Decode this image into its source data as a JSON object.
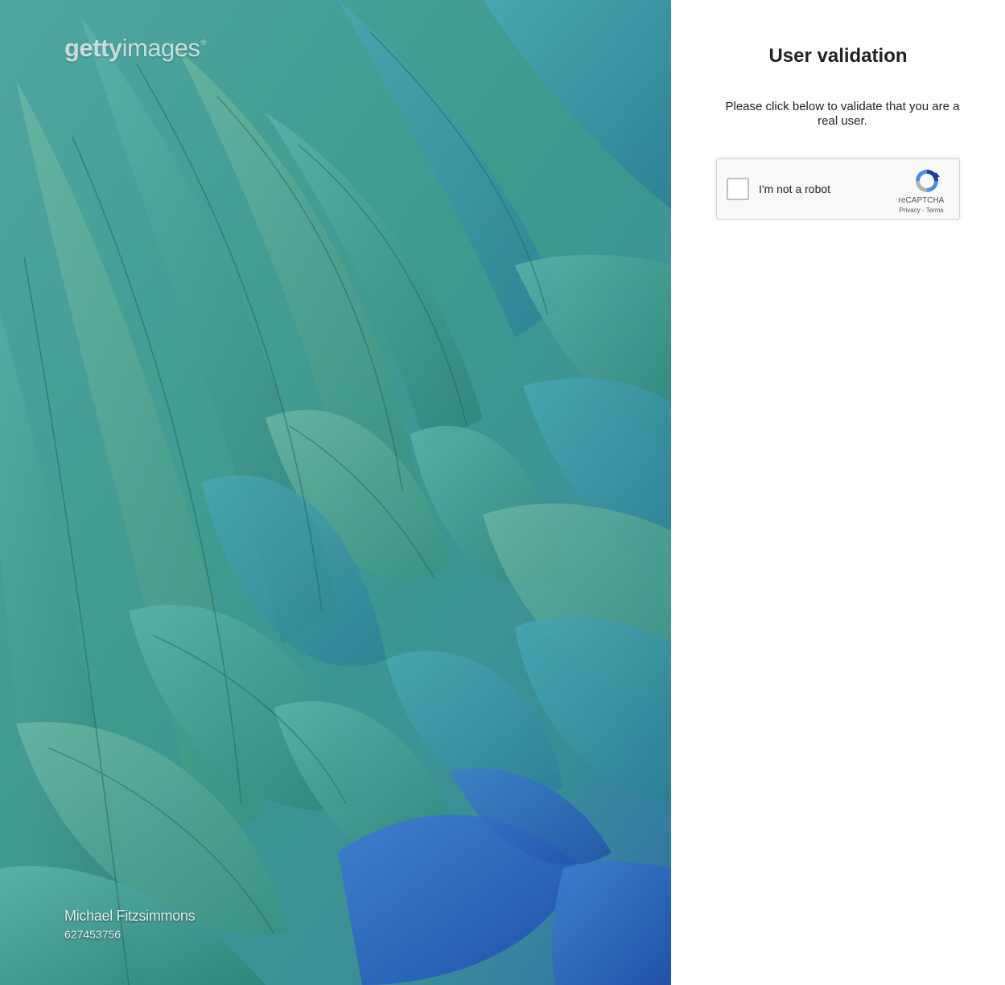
{
  "hero": {
    "logo_bold": "getty",
    "logo_light": "images",
    "logo_mark": "®",
    "photographer": "Michael Fitzsimmons",
    "image_number": "627453756"
  },
  "validation": {
    "title": "User validation",
    "description": "Please click below to validate that you are a real user."
  },
  "recaptcha": {
    "checkbox_label": "I'm not a robot",
    "brand": "reCAPTCHA",
    "privacy_label": "Privacy",
    "separator": "-",
    "terms_label": "Terms",
    "logo_icon": "recaptcha-logo-icon"
  },
  "colors": {
    "feather_teal": "#3f9c95",
    "feather_blue": "#2b5fb8",
    "recaptcha_blue": "#4a90e2"
  }
}
